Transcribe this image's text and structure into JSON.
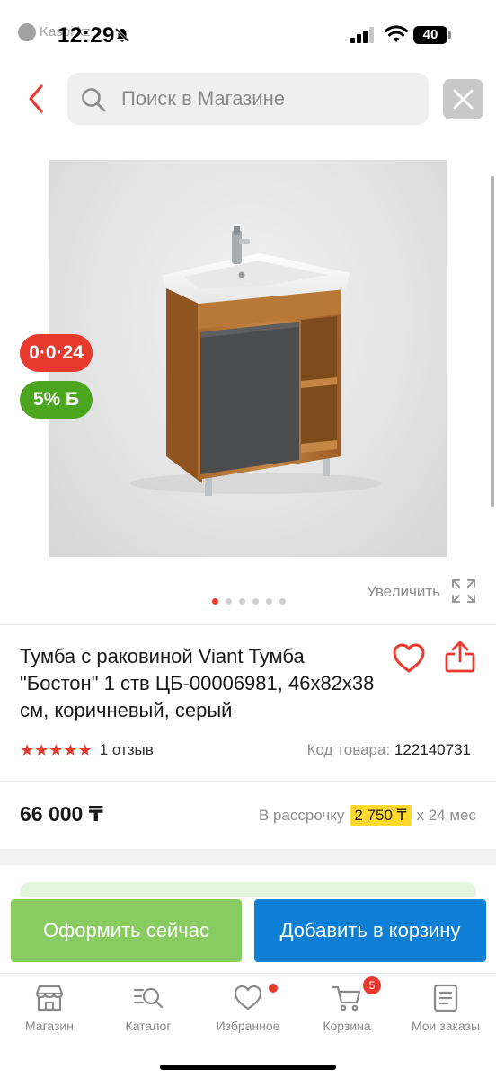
{
  "status_bar": {
    "back_app": "Kaspi.kz",
    "time": "12:29",
    "battery": "40"
  },
  "header": {
    "search_placeholder": "Поиск в Магазине"
  },
  "gallery": {
    "badge_credit": "0·0·24",
    "badge_bonus": "5% Б",
    "zoom_label": "Увеличить",
    "dots_count": 6,
    "active_dot": 0
  },
  "product": {
    "title": "Тумба с раковиной Viant Тумба \"Бостон\" 1 ств ЦБ-00006981, 46x82x38 см, коричневый, серый",
    "stars": "★★★★★",
    "rating": 5,
    "reviews": "1 отзыв",
    "code_label": "Код товара:",
    "code_value": "122140731",
    "price": "66 000 ₸",
    "installment_prefix": "В рассрочку",
    "installment_amount": "2 750 ₸",
    "installment_suffix": "x 24 мес"
  },
  "actions": {
    "buy_now": "Оформить сейчас",
    "add_to_cart": "Добавить в корзину"
  },
  "tabbar": {
    "items": [
      {
        "label": "Магазин",
        "icon": "store-icon"
      },
      {
        "label": "Каталог",
        "icon": "catalog-icon"
      },
      {
        "label": "Избранное",
        "icon": "heart-icon"
      },
      {
        "label": "Корзина",
        "icon": "cart-icon",
        "badge": "5"
      },
      {
        "label": "Мои заказы",
        "icon": "orders-icon"
      }
    ]
  },
  "colors": {
    "accent_red": "#e8392f",
    "bonus_green": "#4ca51f",
    "buy_green": "#88cb61",
    "cart_blue": "#0e7fd5",
    "installment_yellow": "#ffd92e"
  }
}
